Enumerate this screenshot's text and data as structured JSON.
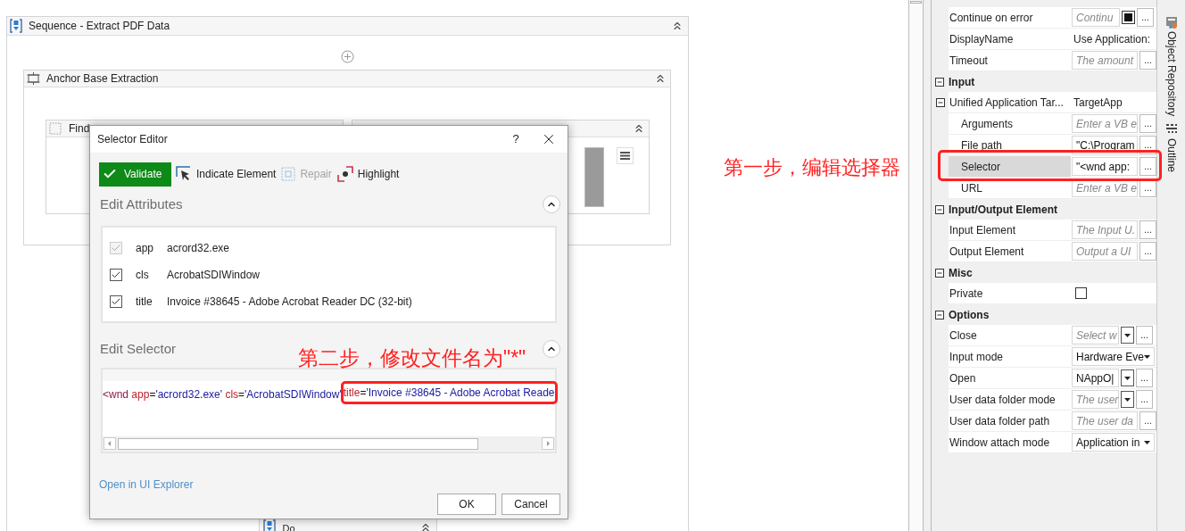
{
  "canvas": {
    "sequence": {
      "title": "Sequence - Extract PDF Data",
      "expanded": true
    },
    "anchor_card": {
      "title": "Anchor Base Extraction",
      "expanded": true
    },
    "inner_cards": [
      {
        "title": "Find"
      },
      {
        "expanded": true
      }
    ],
    "do_card": {
      "title": "Do",
      "expanded": true
    }
  },
  "dialog": {
    "title": "Selector Editor",
    "help": "?",
    "toolbar": [
      {
        "kind": "validate",
        "label": "Validate",
        "disabled": false
      },
      {
        "kind": "indicate",
        "label": "Indicate Element",
        "disabled": false
      },
      {
        "kind": "repair",
        "label": "Repair",
        "disabled": true
      },
      {
        "kind": "highlight",
        "label": "Highlight",
        "disabled": false
      }
    ],
    "attributes_section": {
      "title": "Edit Attributes",
      "expanded": true
    },
    "attributes": [
      {
        "name": "app",
        "value": "acrord32.exe",
        "checked": true,
        "disabled": true
      },
      {
        "name": "cls",
        "value": "AcrobatSDIWindow",
        "checked": true,
        "disabled": false
      },
      {
        "name": "title",
        "value": "Invoice #38645 - Adobe Acrobat Reader DC (32-bit)",
        "checked": true,
        "disabled": false
      }
    ],
    "selector_section": {
      "title": "Edit Selector",
      "expanded": true
    },
    "selector_segments": [
      {
        "framed": false,
        "tokens": [
          {
            "kind": "tag",
            "text": "<wnd "
          },
          {
            "kind": "attr",
            "text": "app"
          },
          {
            "kind": "op",
            "text": "="
          },
          {
            "kind": "value",
            "text": "'acrord32.exe' "
          },
          {
            "kind": "attr",
            "text": "cls"
          },
          {
            "kind": "op",
            "text": "="
          },
          {
            "kind": "value",
            "text": "'AcrobatSDIWindow'"
          }
        ]
      },
      {
        "framed": true,
        "tokens": [
          {
            "kind": "attr",
            "text": "title"
          },
          {
            "kind": "op",
            "text": "="
          },
          {
            "kind": "value",
            "text": "'Invoice #38645 - Adobe Acrobat Reade"
          }
        ]
      }
    ],
    "link": "Open in UI Explorer",
    "buttons": [
      "OK",
      "Cancel"
    ]
  },
  "properties": {
    "sections": [
      {
        "rows": [
          {
            "kind": "toggle",
            "label": "Continue on error",
            "placeholder": "Continu",
            "browse": "...",
            "selected": false
          },
          {
            "kind": "text",
            "label": "DisplayName",
            "value": "Use Application:",
            "selected": false
          },
          {
            "kind": "expression",
            "label": "Timeout",
            "placeholder": "The amount",
            "browse": "...",
            "selected": false
          }
        ]
      },
      {
        "title": "Input",
        "expanded": true,
        "rows": [
          {
            "kind": "text",
            "label": "Unified Application Tar...",
            "value": "TargetApp",
            "expanded": true,
            "selected": false,
            "children": [
              {
                "kind": "expression",
                "label": "Arguments",
                "placeholder": "Enter a VB e",
                "browse": "...",
                "selected": false
              },
              {
                "kind": "expression",
                "label": "File path",
                "value": "\"C:\\Program",
                "browse": "...",
                "selected": false
              },
              {
                "kind": "expression",
                "label": "Selector",
                "value": "\"<wnd app:",
                "browse": "...",
                "selected": true
              },
              {
                "kind": "expression",
                "label": "URL",
                "placeholder": "Enter a VB e",
                "browse": "...",
                "selected": false
              }
            ]
          }
        ]
      },
      {
        "title": "Input/Output Element",
        "expanded": true,
        "rows": [
          {
            "kind": "expression",
            "label": "Input Element",
            "placeholder": "The Input U.",
            "browse": "...",
            "selected": false
          },
          {
            "kind": "expression",
            "label": "Output Element",
            "placeholder": "Output a UI",
            "browse": "...",
            "selected": false
          }
        ]
      },
      {
        "title": "Misc",
        "expanded": true,
        "rows": [
          {
            "kind": "checkbox",
            "label": "Private",
            "checked": false,
            "selected": false
          }
        ]
      },
      {
        "title": "Options",
        "expanded": true,
        "rows": [
          {
            "kind": "combo",
            "label": "Close",
            "placeholder": "Select w",
            "browse": "...",
            "selected": false
          },
          {
            "kind": "dropdown",
            "label": "Input mode",
            "value": "Hardware Eve",
            "selected": false
          },
          {
            "kind": "combo",
            "label": "Open",
            "value": "NAppO|",
            "browse": "...",
            "selected": false
          },
          {
            "kind": "combo",
            "label": "User data folder mode",
            "placeholder": "The user",
            "browse": "...",
            "selected": false
          },
          {
            "kind": "expression",
            "label": "User data folder path",
            "placeholder": "The user da",
            "browse": "...",
            "selected": false
          },
          {
            "kind": "dropdown",
            "label": "Window attach mode",
            "value": "Application in",
            "selected": false
          }
        ]
      }
    ]
  },
  "side_tabs": [
    {
      "kind": "repository",
      "label": "Object Repository"
    },
    {
      "kind": "outline",
      "label": "Outline"
    }
  ],
  "annotations": [
    {
      "text": "第一步，编辑选择器"
    },
    {
      "text": "第二步，修改文件名为\"*\""
    }
  ]
}
